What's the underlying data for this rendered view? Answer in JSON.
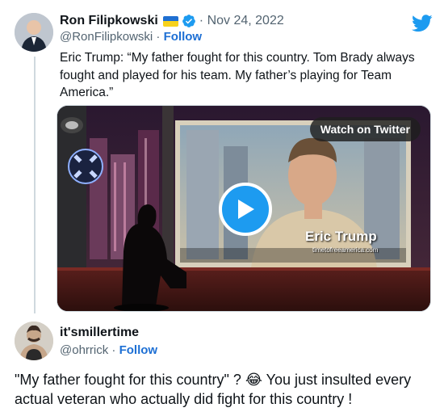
{
  "tweet": {
    "author_name": "Ron Filipkowski",
    "flag_icon": "ukraine-flag-icon",
    "verified_icon": "verified-badge-icon",
    "date": "· Nov 24, 2022",
    "handle": "@RonFilipkowski",
    "separator": " · ",
    "follow_label": "Follow",
    "text": "Eric Trump: “My father fought for this country. Tom Brady always fought and played for his team. My father’s playing for Team America.”",
    "logo_icon": "twitter-bird-icon",
    "brand_color": "#1d9bf0"
  },
  "video": {
    "watch_label": "Watch on Twitter",
    "play_icon": "play-icon",
    "lower_third_name": "Eric Trump",
    "lower_third_url": "timetofreeamerica.com"
  },
  "reply": {
    "author_name": "it'smillertime",
    "handle": "@ohrrick",
    "separator": " · ",
    "follow_label": "Follow",
    "text_before": "\"My father fought for this country\" ? ",
    "emoji": "😂",
    "text_after": " You just insulted every actual veteran who actually did fight for this country !"
  }
}
